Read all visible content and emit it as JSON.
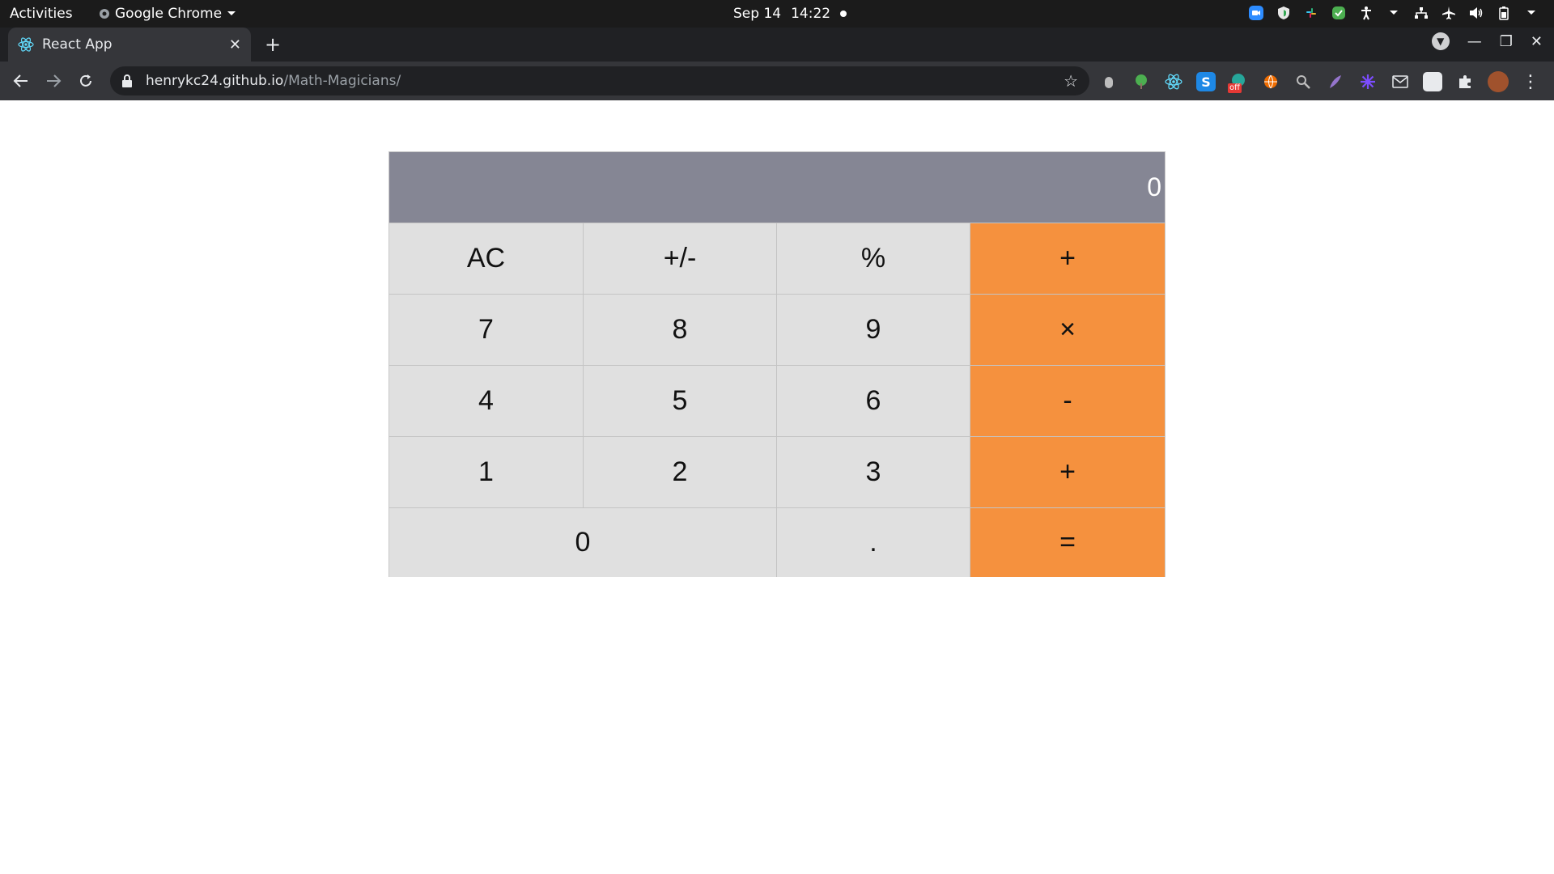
{
  "system_bar": {
    "activities": "Activities",
    "app_name": "Google Chrome",
    "date": "Sep 14",
    "time": "14:22"
  },
  "browser": {
    "tab_title": "React App",
    "url_host": "henrykc24.github.io",
    "url_path": "/Math-Magicians/",
    "ext_badge_off": "off"
  },
  "calculator": {
    "display": "0",
    "rows": [
      [
        "AC",
        "+/-",
        "%",
        "+"
      ],
      [
        "7",
        "8",
        "9",
        "×"
      ],
      [
        "4",
        "5",
        "6",
        "-"
      ],
      [
        "1",
        "2",
        "3",
        "+"
      ],
      [
        "0",
        ".",
        "="
      ]
    ],
    "colors": {
      "display_bg": "#858694",
      "key_bg": "#e0e0e0",
      "operator_bg": "#f5913e"
    }
  }
}
